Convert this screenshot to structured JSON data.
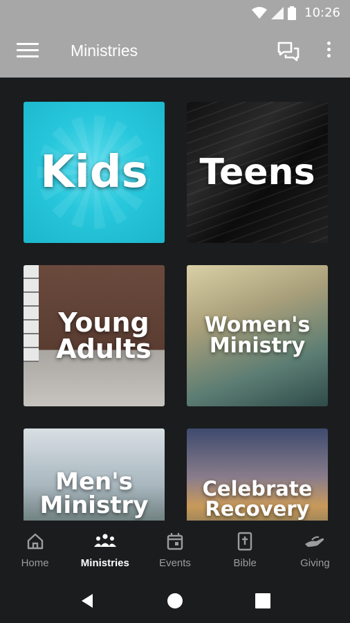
{
  "status_bar": {
    "time": "10:26",
    "icons": [
      "wifi-icon",
      "signal-icon",
      "battery-icon"
    ]
  },
  "app_bar": {
    "title": "Ministries",
    "icons": [
      "menu-icon",
      "chat-icon",
      "more-vert-icon"
    ]
  },
  "ministries": [
    {
      "label": "Kids"
    },
    {
      "label": "Teens"
    },
    {
      "label": "Young\nAdults"
    },
    {
      "label": "Women's\nMinistry"
    },
    {
      "label": "Men's\nMinistry"
    },
    {
      "label": "Celebrate\nRecovery"
    }
  ],
  "bottom_nav": {
    "active": "Ministries",
    "items": [
      {
        "label": "Home",
        "icon": "home-icon"
      },
      {
        "label": "Ministries",
        "icon": "people-icon"
      },
      {
        "label": "Events",
        "icon": "calendar-icon"
      },
      {
        "label": "Bible",
        "icon": "bible-icon"
      },
      {
        "label": "Giving",
        "icon": "giving-hand-icon"
      }
    ]
  },
  "system_nav": [
    "back-icon",
    "home-circle-icon",
    "recents-icon"
  ],
  "colors": {
    "app_bar": "#a7a7a7",
    "background": "#1b1c1e",
    "inactive_nav": "#9c9c9c",
    "active_nav": "#ffffff"
  }
}
